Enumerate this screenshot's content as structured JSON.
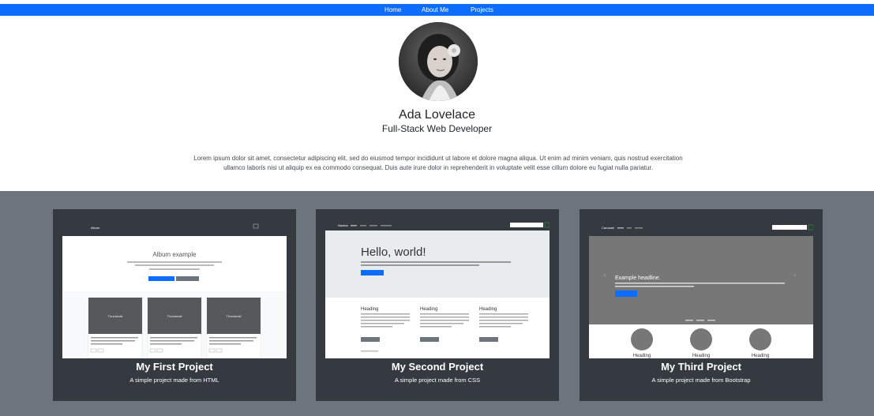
{
  "nav": {
    "items": [
      "Home",
      "About Me",
      "Projects"
    ]
  },
  "hero": {
    "name": "Ada Lovelace",
    "role": "Full-Stack Web Developer",
    "bio": "Lorem ipsum dolor sit amet, consectetur adipiscing elit, sed do eiusmod tempor incididunt ut labore et dolore magna aliqua. Ut enim ad minim veniam, quis nostrud exercitation ullamco laboris nisi ut aliquip ex ea commodo consequat. Duis aute irure dolor in reprehenderit in voluptate velit esse cillum dolore eu fugiat nulla pariatur."
  },
  "projects": [
    {
      "title": "My First Project",
      "description": "A simple project made from HTML",
      "preview": {
        "brand": "Album",
        "heading": "Album example",
        "thumbnails": [
          "Thumbnail",
          "Thumbnail",
          "Thumbnail"
        ]
      }
    },
    {
      "title": "My Second Project",
      "description": "A simple project made from CSS",
      "preview": {
        "brand": "Navbar",
        "heading": "Hello, world!",
        "columns": [
          "Heading",
          "Heading",
          "Heading"
        ]
      }
    },
    {
      "title": "My Third Project",
      "description": "A simple project made from Bootstrap",
      "preview": {
        "brand": "Carousel",
        "heading": "Example headline.",
        "columns": [
          "Heading",
          "Heading",
          "Heading"
        ]
      }
    }
  ]
}
